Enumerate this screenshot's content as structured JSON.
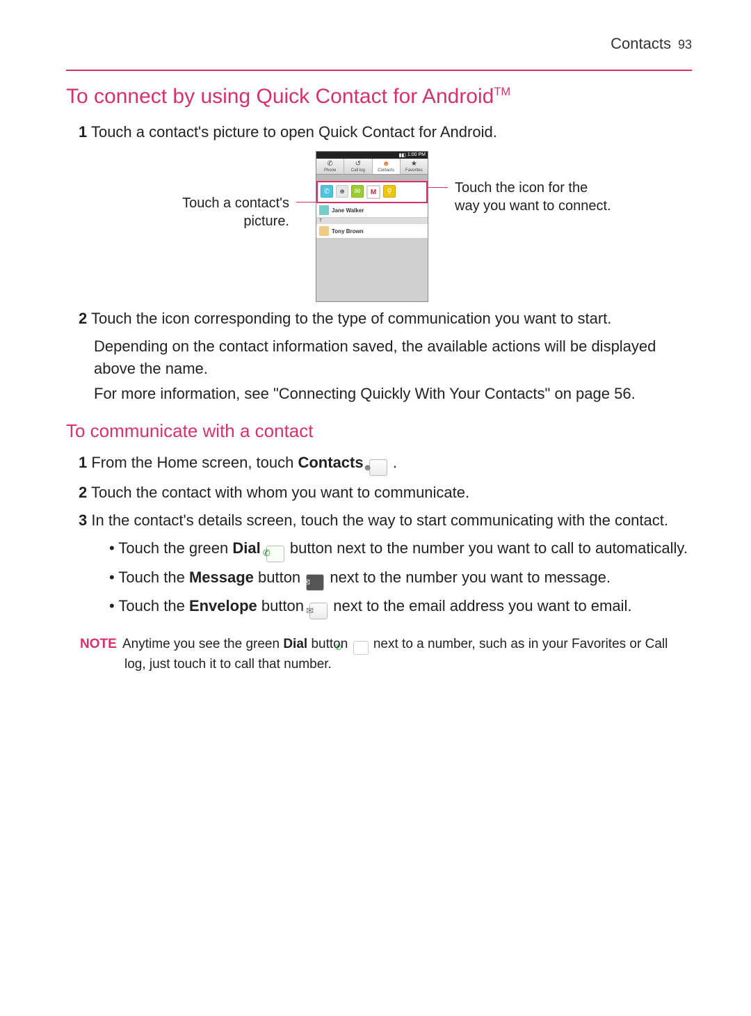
{
  "header": {
    "section": "Contacts",
    "page": "93"
  },
  "h1": {
    "text": "To connect by using Quick Contact for Android",
    "tm": "TM"
  },
  "step1": {
    "n": "1",
    "text": " Touch a contact's picture to open Quick Contact for Android."
  },
  "figure": {
    "left_caption": "Touch a contact's picture.",
    "right_caption": "Touch the icon for the way you want to connect.",
    "statusbar_time": "1:00 PM",
    "tabs": {
      "phone": "Phone",
      "calllog": "Call log",
      "contacts": "Contacts",
      "favorites": "Favorites"
    },
    "contact1": "Jane Walker",
    "section_letter": "T",
    "contact2": "Tony Brown",
    "gmail_m": "M"
  },
  "step2": {
    "n": "2",
    "line1": " Touch the icon corresponding to the type of communication you want to start.",
    "line2": "Depending on the contact information saved, the available actions will be displayed above the name.",
    "line3": "For more information, see \"Connecting Quickly With Your Contacts\" on page 56."
  },
  "h2": "To communicate with a contact",
  "c1": {
    "n": "1",
    "a": " From the Home screen, touch ",
    "bold": "Contacts",
    "b": " ."
  },
  "c2": {
    "n": "2",
    "text": " Touch the contact with whom you want to communicate."
  },
  "c3": {
    "n": "3",
    "text": " In the contact's details screen, touch the way to start communicating with the contact."
  },
  "b1": {
    "a": "Touch the green ",
    "bold": "Dial",
    "b": " button next to the number you want to call to automatically."
  },
  "b2": {
    "a": "Touch the ",
    "bold": "Message",
    "b": " button ",
    "c": " next to the number you want to message."
  },
  "b3": {
    "a": "Touch the ",
    "bold": "Envelope",
    "b": " button ",
    "c": " next to the email address you want to email."
  },
  "note": {
    "label": "NOTE",
    "a": " Anytime you see the green ",
    "bold": "Dial",
    "b": " button ",
    "c": " next to a number, such as in your Favorites or Call log, just touch it to call that  number."
  }
}
